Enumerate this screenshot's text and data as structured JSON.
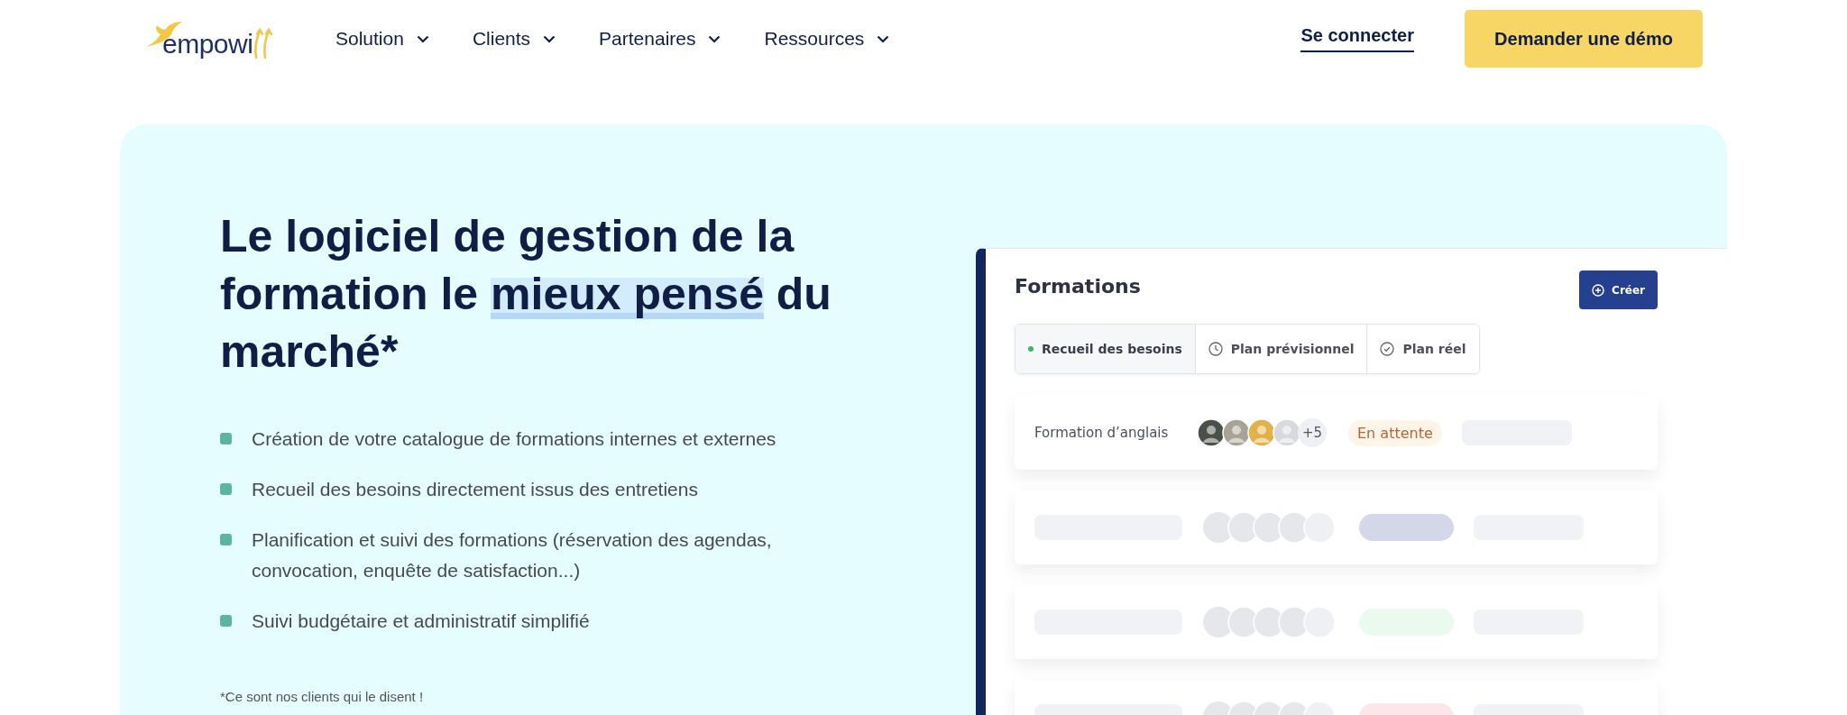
{
  "header": {
    "logo_text": "empowi",
    "nav": [
      {
        "label": "Solution"
      },
      {
        "label": "Clients"
      },
      {
        "label": "Partenaires"
      },
      {
        "label": "Ressources"
      }
    ],
    "login": "Se connecter",
    "demo": "Demander une démo"
  },
  "hero": {
    "heading_before": "Le logiciel de gestion de la formation le ",
    "heading_highlight": "mieux pensé",
    "heading_after": " du marché*",
    "bullets": [
      "Création de votre catalogue de formations internes et externes",
      "Recueil des besoins directement issus des entretiens",
      "Planification et suivi des formations (réservation des agendas, convocation, enquête de satisfaction...)",
      "Suivi budgétaire et administratif simplifié"
    ],
    "footnote": "*Ce sont nos clients qui le disent !"
  },
  "app": {
    "title": "Formations",
    "create": "Créer",
    "tabs": [
      {
        "label": "Recueil des besoins",
        "kind": "dot",
        "selected": true
      },
      {
        "label": "Plan prévisionnel",
        "kind": "clock",
        "selected": false
      },
      {
        "label": "Plan réel",
        "kind": "check",
        "selected": false
      }
    ],
    "row": {
      "name": "Formation d’anglais",
      "avatars": [
        {
          "color": "#4a4f48"
        },
        {
          "color": "#a8a396"
        },
        {
          "color": "#e2b24a"
        },
        {
          "color": "#d8d9dc"
        }
      ],
      "more": "+5",
      "status": "En attente"
    },
    "placeholder_rows": [
      {
        "color": "#d3d7e8"
      },
      {
        "color": "#eafaee"
      },
      {
        "color": "#fde6ea"
      }
    ]
  }
}
